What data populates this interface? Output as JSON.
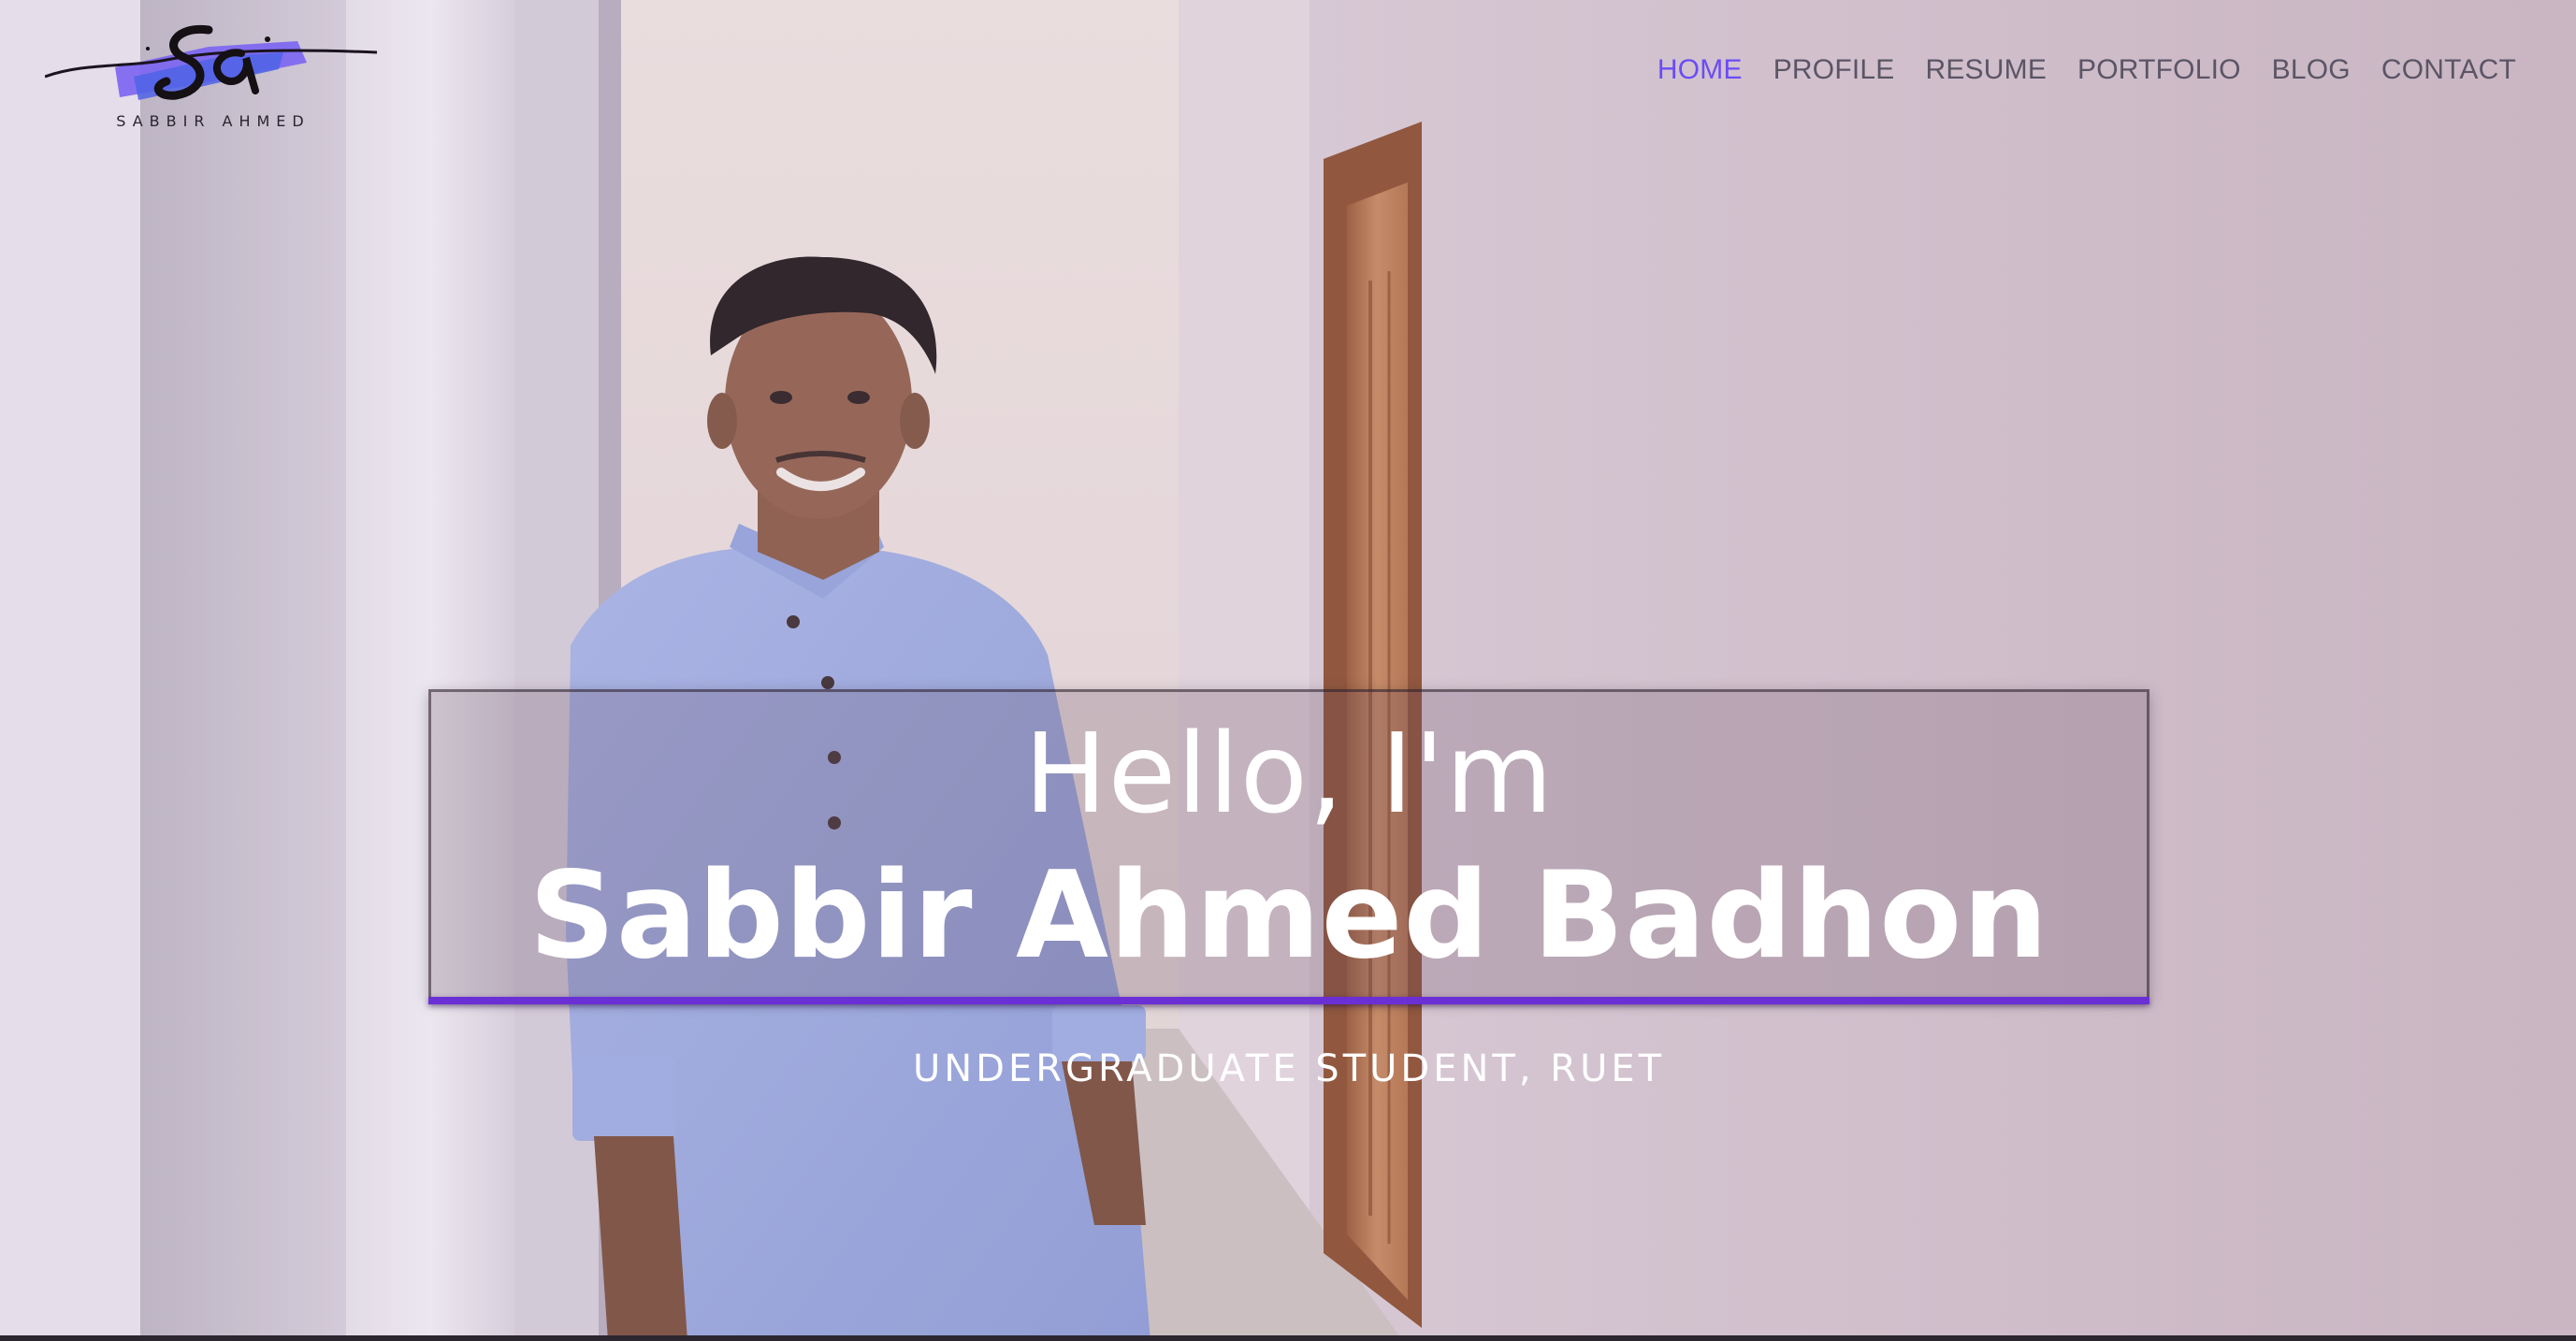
{
  "brand": {
    "logo_name": "SABBIR AHMED",
    "logo_icon": "signature-logo-icon"
  },
  "nav": {
    "items": [
      {
        "label": "HOME",
        "active": true
      },
      {
        "label": "PROFILE",
        "active": false
      },
      {
        "label": "RESUME",
        "active": false
      },
      {
        "label": "PORTFOLIO",
        "active": false
      },
      {
        "label": "BLOG",
        "active": false
      },
      {
        "label": "CONTACT",
        "active": false
      }
    ]
  },
  "hero": {
    "greeting": "Hello, I'm",
    "name": "Sabbir Ahmed Badhon",
    "tagline": "UNDERGRADUATE STUDENT, RUET"
  },
  "colors": {
    "accent": "#6a4cf5",
    "underline": "#6b2fd6",
    "nav_text": "#5b5566",
    "hero_text": "#ffffff"
  }
}
